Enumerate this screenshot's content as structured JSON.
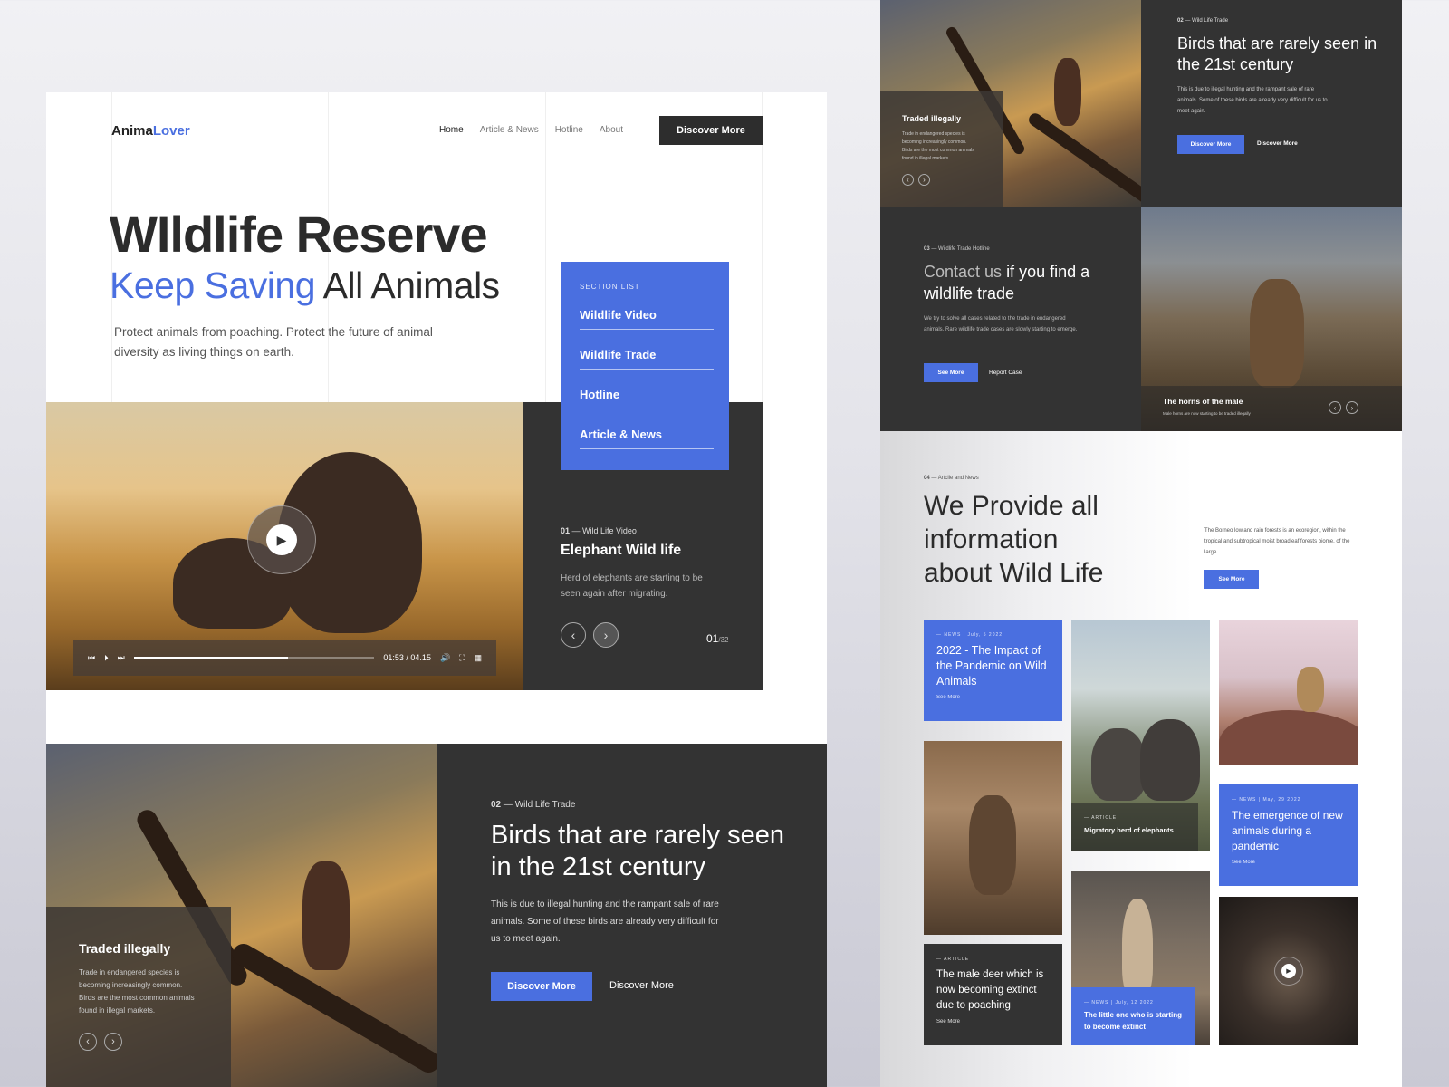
{
  "brand": {
    "name_part1": "Anima",
    "name_part2": "Lover"
  },
  "nav": {
    "items": [
      "Home",
      "Article & News",
      "Hotline",
      "About"
    ],
    "cta": "Discover More"
  },
  "hero": {
    "title": "WIldlife Reserve",
    "subtitle_blue": "Keep Saving",
    "subtitle_dark": "All Animals",
    "lead": "Protect animals from poaching. Protect the future of animal diversity as living things on earth."
  },
  "section_list": {
    "title": "SECTION LIST",
    "items": [
      "Wildlife Video",
      "Wildlife Trade",
      "Hotline",
      "Article & News"
    ]
  },
  "video": {
    "current": "01:53",
    "total": "04.15",
    "progress": 0.64,
    "separator": "/"
  },
  "video_info": {
    "index": "01",
    "dash": "—",
    "category": "Wild Life Video",
    "title": "Elephant Wild life",
    "desc": "Herd of elephants are starting to be seen again after migrating.",
    "page_current": "01",
    "page_total": "/32"
  },
  "trade": {
    "index": "02",
    "dash": "—",
    "category": "Wild Life Trade",
    "title": "Birds that are rarely seen in the 21st century",
    "desc": "This is due to illegal hunting and the rampant sale of rare animals. Some of these birds are already very difficult for us to meet again.",
    "btn_primary": "Discover More",
    "btn_secondary": "Discover More",
    "card_title": "Traded illegally",
    "card_desc": "Trade in endangered species is becoming increasingly common. Birds are the most common animals found in illegal markets."
  },
  "hotline": {
    "index": "03",
    "dash": "—",
    "category": "Wildlife Trade Hotline",
    "title_a": "Contact us",
    "title_b": "if you find",
    "title_c": "a wildlife trade",
    "desc": "We try to solve all cases related to the trade in endangered animals. Rare wildlife trade cases are slowly starting to emerge.",
    "btn_primary": "See More",
    "btn_secondary": "Report Case",
    "caption_title": "The horns of the male",
    "caption_desc": "Male horns are now starting to be traded illegally"
  },
  "news": {
    "index": "04",
    "dash": "—",
    "category": "Artcile and News",
    "title": "We Provide all information about Wild Life",
    "desc": "The Borneo lowland rain forests is an ecoregion, within the tropical and subtropical moist broadleaf forests biome, of the large..",
    "btn": "See More",
    "card1": {
      "tag": "— NEWS | July, 5 2022",
      "title": "2022 - The Impact of the Pandemic on Wild Animals",
      "link": "See More"
    },
    "card2": {
      "tag": "— ARTICLE",
      "title": "Migratory herd of elephants"
    },
    "card3": {
      "tag": "— NEWS | May, 29 2022",
      "title": "The emergence of new animals during a pandemic",
      "link": "See More"
    },
    "card4": {
      "tag": "— ARTICLE",
      "title": "The male deer which is now becoming extinct due to poaching",
      "link": "See More"
    },
    "card5": {
      "tag": "— NEWS | July, 12 2022",
      "title": "The little one who is starting to become extinct"
    }
  },
  "colors": {
    "accent": "#4a6fe0",
    "dark": "#333333",
    "page": "#ffffff"
  }
}
